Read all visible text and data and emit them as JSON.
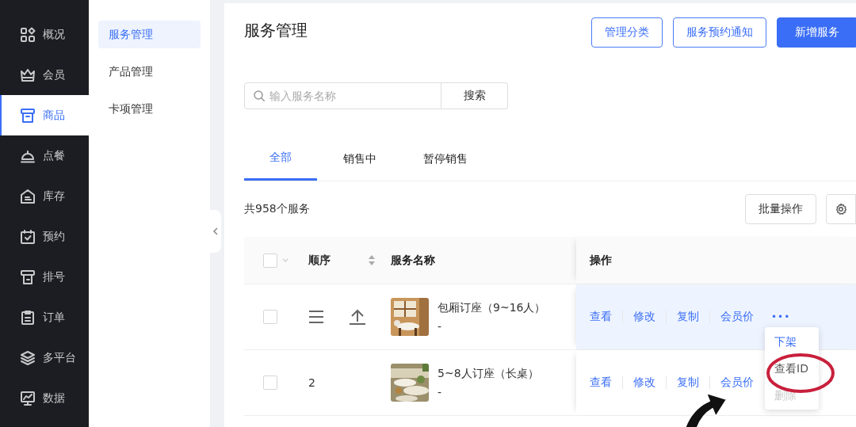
{
  "nav": {
    "items": [
      {
        "label": "概况",
        "selected": false
      },
      {
        "label": "会员",
        "selected": false
      },
      {
        "label": "商品",
        "selected": true
      },
      {
        "label": "点餐",
        "selected": false
      },
      {
        "label": "库存",
        "selected": false
      },
      {
        "label": "预约",
        "selected": false
      },
      {
        "label": "排号",
        "selected": false
      },
      {
        "label": "订单",
        "selected": false
      },
      {
        "label": "多平台",
        "selected": false
      },
      {
        "label": "数据",
        "selected": false
      }
    ]
  },
  "submenu": {
    "items": [
      {
        "label": "服务管理",
        "selected": true
      },
      {
        "label": "产品管理",
        "selected": false
      },
      {
        "label": "卡项管理",
        "selected": false
      }
    ]
  },
  "page": {
    "title": "服务管理",
    "buttons": [
      {
        "label": "管理分类",
        "kind": "outline"
      },
      {
        "label": "服务预约通知",
        "kind": "outline"
      },
      {
        "label": "新增服务",
        "kind": "primary"
      }
    ],
    "search": {
      "placeholder": "输入服务名称",
      "button": "搜索"
    },
    "tabs": [
      {
        "label": "全部",
        "selected": true
      },
      {
        "label": "销售中",
        "selected": false
      },
      {
        "label": "暂停销售",
        "selected": false
      }
    ],
    "count": "共958个服务",
    "bulk_button": "批量操作",
    "table": {
      "header_checked": false,
      "columns": [
        "顺序",
        "服务名称",
        "操作"
      ],
      "rows": [
        {
          "kind": "pinned",
          "checked": false,
          "highlighted": true,
          "name": "包厢订座（9~16人）",
          "subtitle": "-",
          "actions": [
            "查看",
            "修改",
            "复制",
            "会员价"
          ],
          "more": "•••"
        },
        {
          "kind": "number",
          "order": "2",
          "checked": false,
          "highlighted": false,
          "name": "5~8人订座（长桌）",
          "subtitle": "-",
          "actions": [
            "查看",
            "修改",
            "复制",
            "会员价"
          ]
        }
      ]
    },
    "dropdown": {
      "items": [
        {
          "label": "下架",
          "disabled": false,
          "kind": "link"
        },
        {
          "label": "查看ID",
          "disabled": false,
          "kind": "plain"
        },
        {
          "label": "删除",
          "disabled": true,
          "kind": "plain"
        }
      ]
    }
  }
}
